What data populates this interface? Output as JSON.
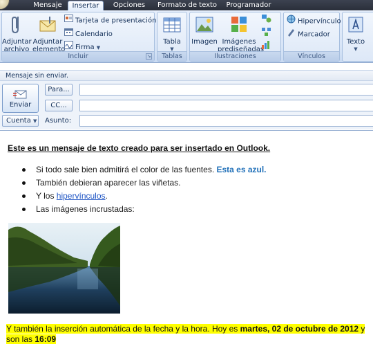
{
  "tabs": [
    {
      "label": "Mensaje",
      "active": false
    },
    {
      "label": "Insertar",
      "active": true
    },
    {
      "label": "Opciones",
      "active": false
    },
    {
      "label": "Formato de texto",
      "active": false
    },
    {
      "label": "Programador",
      "active": false
    }
  ],
  "ribbon": {
    "incluir": {
      "label": "Incluir",
      "adjuntar_archivo": [
        "Adjuntar",
        "archivo"
      ],
      "adjuntar_elemento": [
        "Adjuntar",
        "elemento"
      ],
      "tarjeta": "Tarjeta de presentación",
      "calendario": "Calendario",
      "firma": "Firma"
    },
    "tablas": {
      "label": "Tablas",
      "tabla": "Tabla"
    },
    "ilustraciones": {
      "label": "Ilustraciones",
      "imagen": "Imagen",
      "imagenes_prediseñadas": [
        "Imágenes",
        "prediseñadas"
      ]
    },
    "vinculos": {
      "label": "Vínculos",
      "hipervinculo": "Hipervínculo",
      "marcador": "Marcador"
    },
    "texto": {
      "label": "Texto"
    }
  },
  "infobar": "Mensaje sin enviar.",
  "header": {
    "enviar": "Enviar",
    "para": "Para...",
    "cc": "CC...",
    "cuenta": "Cuenta",
    "asunto": "Asunto:"
  },
  "body": {
    "title": "Este es un mensaje de texto creado para ser insertado en Outlook.",
    "bullets": {
      "b1_text": "Si todo sale bien admitirá el color de las fuentes. ",
      "b1_blue": "Esta es azul.",
      "b2": "También debieran aparecer las viñetas.",
      "b3_pre": "Y los ",
      "b3_link": "hipervínculos",
      "b3_post": ".",
      "b4": "Las imágenes incrustadas:"
    },
    "footer": {
      "pre": "Y también la inserción automática de la fecha y la hora. Hoy es ",
      "date": "martes, 02 de octubre de 2012",
      "mid": " y son las ",
      "time": "16:09"
    }
  }
}
